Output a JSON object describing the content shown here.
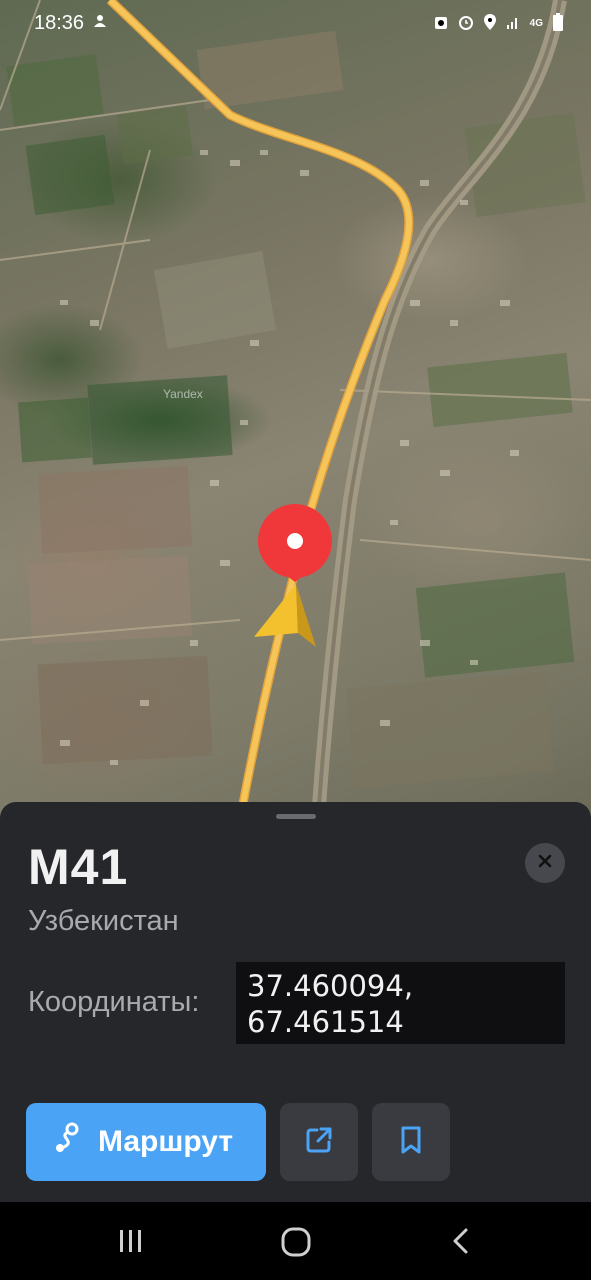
{
  "status_bar": {
    "time": "18:36",
    "network": "4G",
    "icons": [
      "baby-alert-icon",
      "recorder-icon",
      "alarm-icon",
      "location-icon",
      "signal-icon",
      "4g-icon",
      "battery-icon"
    ]
  },
  "map": {
    "watermark": "Yandex",
    "marker_icon": "location-pin-icon",
    "user_icon": "navigation-arrow-icon",
    "route_color": "#f2b94c",
    "pin_color": "#f0383a"
  },
  "sheet": {
    "title": "M41",
    "subtitle": "Узбекистан",
    "coordinates_label": "Координаты:",
    "coordinates_line1": "37.460094,",
    "coordinates_line2": "67.461514",
    "route_button_label": "Маршрут",
    "route_icon": "route-icon",
    "share_icon": "share-icon",
    "bookmark_icon": "bookmark-icon",
    "close_icon": "close-icon",
    "accent_color": "#4aa3f5"
  },
  "nav_bar": {
    "icons": [
      "recent-apps-icon",
      "home-icon",
      "back-icon"
    ]
  }
}
